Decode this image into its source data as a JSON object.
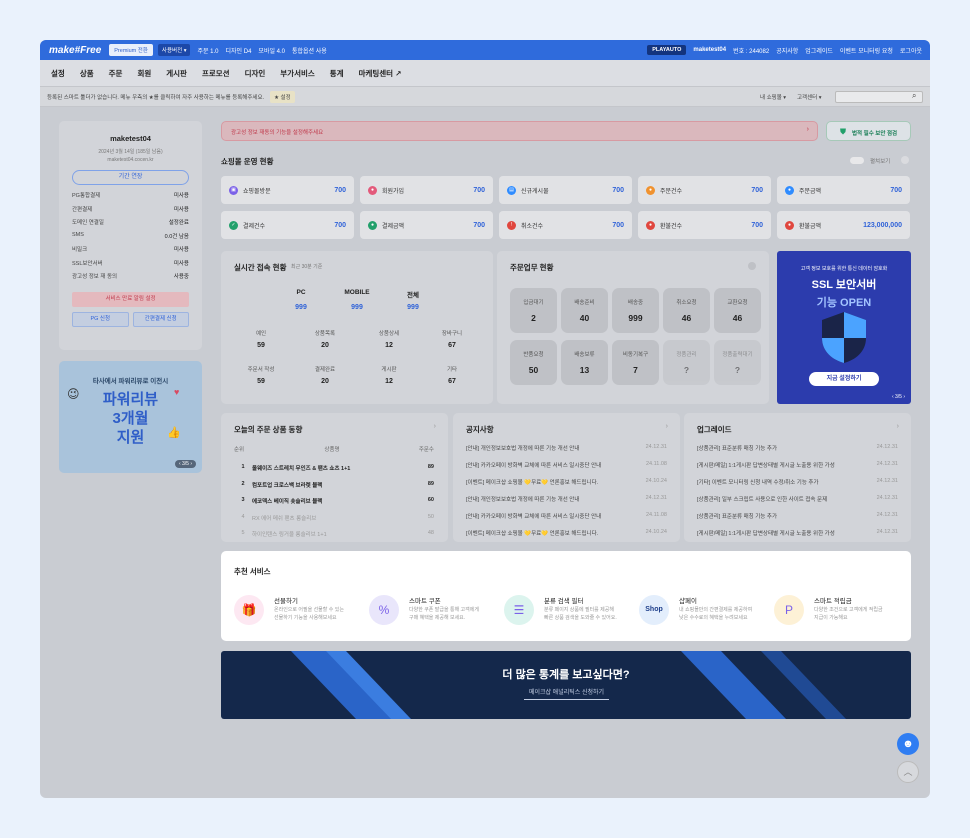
{
  "topbar": {
    "logo": "make#Free",
    "premium": "Premium 전환",
    "user_version": "사용버전 ▾",
    "links": [
      "주문 1.0",
      "디자인 D4",
      "모바일 4.0",
      "통합옵션 사용"
    ],
    "playauto": "PLAYAUTO",
    "account": "maketest04",
    "id_text": "번호 : 244082",
    "right_links": [
      "공지사항",
      "업그레이드",
      "이벤트 모니터링 요청",
      "로그아웃"
    ]
  },
  "menu": [
    "설정",
    "상품",
    "주문",
    "회원",
    "게시판",
    "프로모션",
    "디자인",
    "부가서비스",
    "통계",
    "마케팅센터 ↗"
  ],
  "notice": {
    "text": "등록된 스마트 툴더가 없습니다. 메뉴 우측의 ★를 클릭하여 자주 사용하는 메뉴를 등록해주세요.",
    "setting": "★ 설정",
    "shop_select": "내 쇼핑몰 ▾",
    "customer": "고객센터 ▾"
  },
  "profile": {
    "name": "maketest04",
    "date": "2024년 3월 14일 (185일 남음)",
    "domain": "maketest04.cocen.kr",
    "extend": "기간 연장",
    "items": [
      [
        "PG통합결제",
        "미사용"
      ],
      [
        "간편결제",
        "미사용"
      ],
      [
        "도메인 연결일",
        "설정완료"
      ],
      [
        "SMS",
        "0.0건 남음"
      ],
      [
        "비밀크",
        "미사용"
      ],
      [
        "SSL보안서버",
        "미사용"
      ],
      [
        "광고성 정보 재 동의",
        "사용중"
      ]
    ],
    "btn_alert": "서비스 만료 알림 설정",
    "btn_pg": "PG 신청",
    "btn_easy": "간편결제 신청"
  },
  "banner_left": {
    "line1": "타사에서 파워리뷰로 이전시",
    "line2": "파워리뷰",
    "line3": "3개월",
    "line4": "지원",
    "pager": "‹ 3/5 ›"
  },
  "alert": {
    "text": "광고성 정보 재동의 기능을 설정해주세요",
    "chev": "›",
    "btn": "법적 필수 보안 점검"
  },
  "shop_status": {
    "title": "쇼핑몰 운영 현황",
    "toggle_label": "펼쳐보기",
    "items": [
      [
        "쇼핑몰방문",
        "700"
      ],
      [
        "회원가입",
        "700"
      ],
      [
        "신규게시물",
        "700"
      ],
      [
        "주문건수",
        "700"
      ],
      [
        "주문금액",
        "700"
      ],
      [
        "결제건수",
        "700"
      ],
      [
        "결제금액",
        "700"
      ],
      [
        "취소건수",
        "700"
      ],
      [
        "환불건수",
        "700"
      ],
      [
        "환불금액",
        "123,000,000"
      ]
    ]
  },
  "realtime": {
    "title": "실시간 접속 현황",
    "sub": "최근 30분 기준",
    "cols": [
      "PC",
      "MOBILE",
      "전체"
    ],
    "vals": [
      "999",
      "999",
      "999"
    ],
    "grid": [
      [
        "예인",
        "59"
      ],
      [
        "상품목록",
        "20"
      ],
      [
        "상품상세",
        "12"
      ],
      [
        "장바구니",
        "67"
      ],
      [
        "주문서 작성",
        "59"
      ],
      [
        "결제완료",
        "20"
      ],
      [
        "게시판",
        "12"
      ],
      [
        "기타",
        "67"
      ]
    ]
  },
  "orders": {
    "title": "주문업무 현황",
    "items": [
      [
        "입금대기",
        "2"
      ],
      [
        "배송준비",
        "40"
      ],
      [
        "배송중",
        "999"
      ],
      [
        "취소요청",
        "46"
      ],
      [
        "교환요청",
        "46"
      ],
      [
        "반품요청",
        "50"
      ],
      [
        "배송보류",
        "13"
      ],
      [
        "비동기복구",
        "7"
      ],
      [
        "정품관리",
        "?"
      ],
      [
        "정품출력대기",
        "?"
      ]
    ]
  },
  "ssl": {
    "small": "고객 정보 보호를 위한 통신 데이터 암호화",
    "big1": "SSL 보안서버",
    "big2": "기능 OPEN",
    "btn": "지금 설정하기",
    "pager": "‹ 3/5 ›"
  },
  "ranking": {
    "title": "오늘의 주문 상품 동향",
    "cols": [
      "순위",
      "상품명",
      "주문수"
    ],
    "rows": [
      [
        "1",
        "올웨이즈 스트레치 무인즈 & 팬츠 쇼츠 1+1",
        "89"
      ],
      [
        "2",
        "컴포트업 크로스백 브라렛 블랙",
        "89"
      ],
      [
        "3",
        "에코덱스 베이직 숏슬리브 블랙",
        "60"
      ],
      [
        "4",
        "RX 에어 메쉬 팬츠 롱슬리브",
        "50"
      ],
      [
        "5",
        "하이인텐스 링거울 롱슬리브 1+1",
        "48"
      ]
    ]
  },
  "notices": {
    "title": "공지사항",
    "rows": [
      [
        "[안내] 개인정보보호법 개정에 따른 기능 개선 안내",
        "24.12.31"
      ],
      [
        "[안내] 카카오페이 방화벽 교체에 따른 서비스 일시중단 안내",
        "24.11.08"
      ],
      [
        "[이벤트] 메이크샵 쇼핑몰 💛무료💛 언론홍보 해드립니다.",
        "24.10.24"
      ],
      [
        "[안내] 개인정보보호법 개정에 따른 기능 개선 안내",
        "24.12.31"
      ],
      [
        "[안내] 카카오페이 방화벽 교체에 따른 서비스 일시중단 안내",
        "24.11.08"
      ],
      [
        "[이벤트] 메이크샵 쇼핑몰 💛무료💛 언론홍보 해드립니다.",
        "24.10.24"
      ]
    ]
  },
  "upgrades": {
    "title": "업그레이드",
    "rows": [
      [
        "[상품관리] 표준분류 매칭 기능 추가",
        "24.12.31"
      ],
      [
        "[게시판/메일] 1:1게시판 답변상태별 게시글 노출용 위한 가성",
        "24.12.31"
      ],
      [
        "[기타] 이벤트 모니터링 신청 내역 수정/취소 기능 추가",
        "24.12.31"
      ],
      [
        "[상품관리] 일부 스크립트 사용으로 인한 사이트 접속 문제",
        "24.12.31"
      ],
      [
        "[상품관리] 표준분류 매칭 기능 추가",
        "24.12.31"
      ],
      [
        "[게시판/메일] 1:1게시판 답변상태별 게시글 노출용 위한 가성",
        "24.12.31"
      ]
    ]
  },
  "recommend": {
    "title": "추천 서비스",
    "items": [
      {
        "name": "선물하기",
        "desc1": "온라인으로 어필을 선물할 수 있는",
        "desc2": "선물하기 기능을 사용해보세요",
        "color": "#fde8f2",
        "icon": "🎁"
      },
      {
        "name": "스마트 쿠폰",
        "desc1": "다양한 쿠폰 발급을 통해 고객에게",
        "desc2": "구매 혜택을 제공해 보세요.",
        "color": "#e9e6fb",
        "icon": "%"
      },
      {
        "name": "분류 검색 필터",
        "desc1": "분류 페이지 상품에 필터를 제공해",
        "desc2": "빠른 상품 검색을 도와줄 수 있어요.",
        "color": "#dcf4ee",
        "icon": "☰"
      },
      {
        "name": "샵페이",
        "desc1": "내 쇼핑몰만의 간편결제를 제공하여",
        "desc2": "낮은 수수료의 혜택을 누려보세요",
        "color": "#e3eefc",
        "icon": "Shop"
      },
      {
        "name": "스마트 적립금",
        "desc1": "다양한 조건으로 고객에게 적립금",
        "desc2": "지급이 가능해요",
        "color": "#fdf1d6",
        "icon": "P"
      }
    ]
  },
  "stats_banner": {
    "title": "더 많은 통계를 보고싶다면?",
    "link": "메이크샵 애널리틱스 신청하기"
  }
}
